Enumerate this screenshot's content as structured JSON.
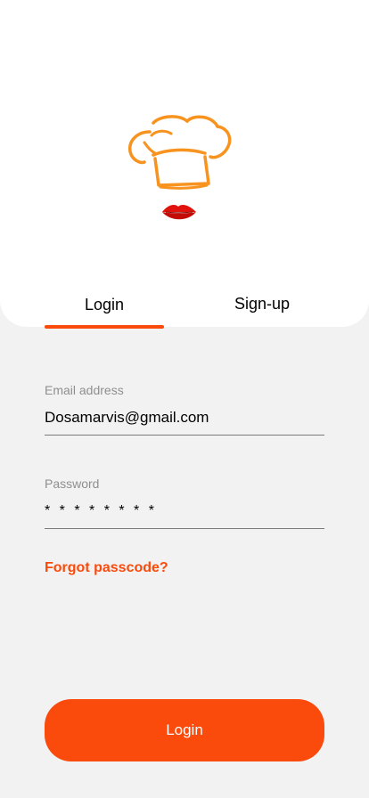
{
  "brand": {
    "accent_color": "#fa4a0c",
    "logo_icon": "chef-hat-lips-logo"
  },
  "tabs": [
    {
      "label": "Login",
      "active": true
    },
    {
      "label": "Sign-up",
      "active": false
    }
  ],
  "form": {
    "email": {
      "label": "Email address",
      "value": "Dosamarvis@gmail.com"
    },
    "password": {
      "label": "Password",
      "value": "* * * * * * * *"
    },
    "forgot_link": "Forgot passcode?",
    "submit_label": "Login"
  }
}
